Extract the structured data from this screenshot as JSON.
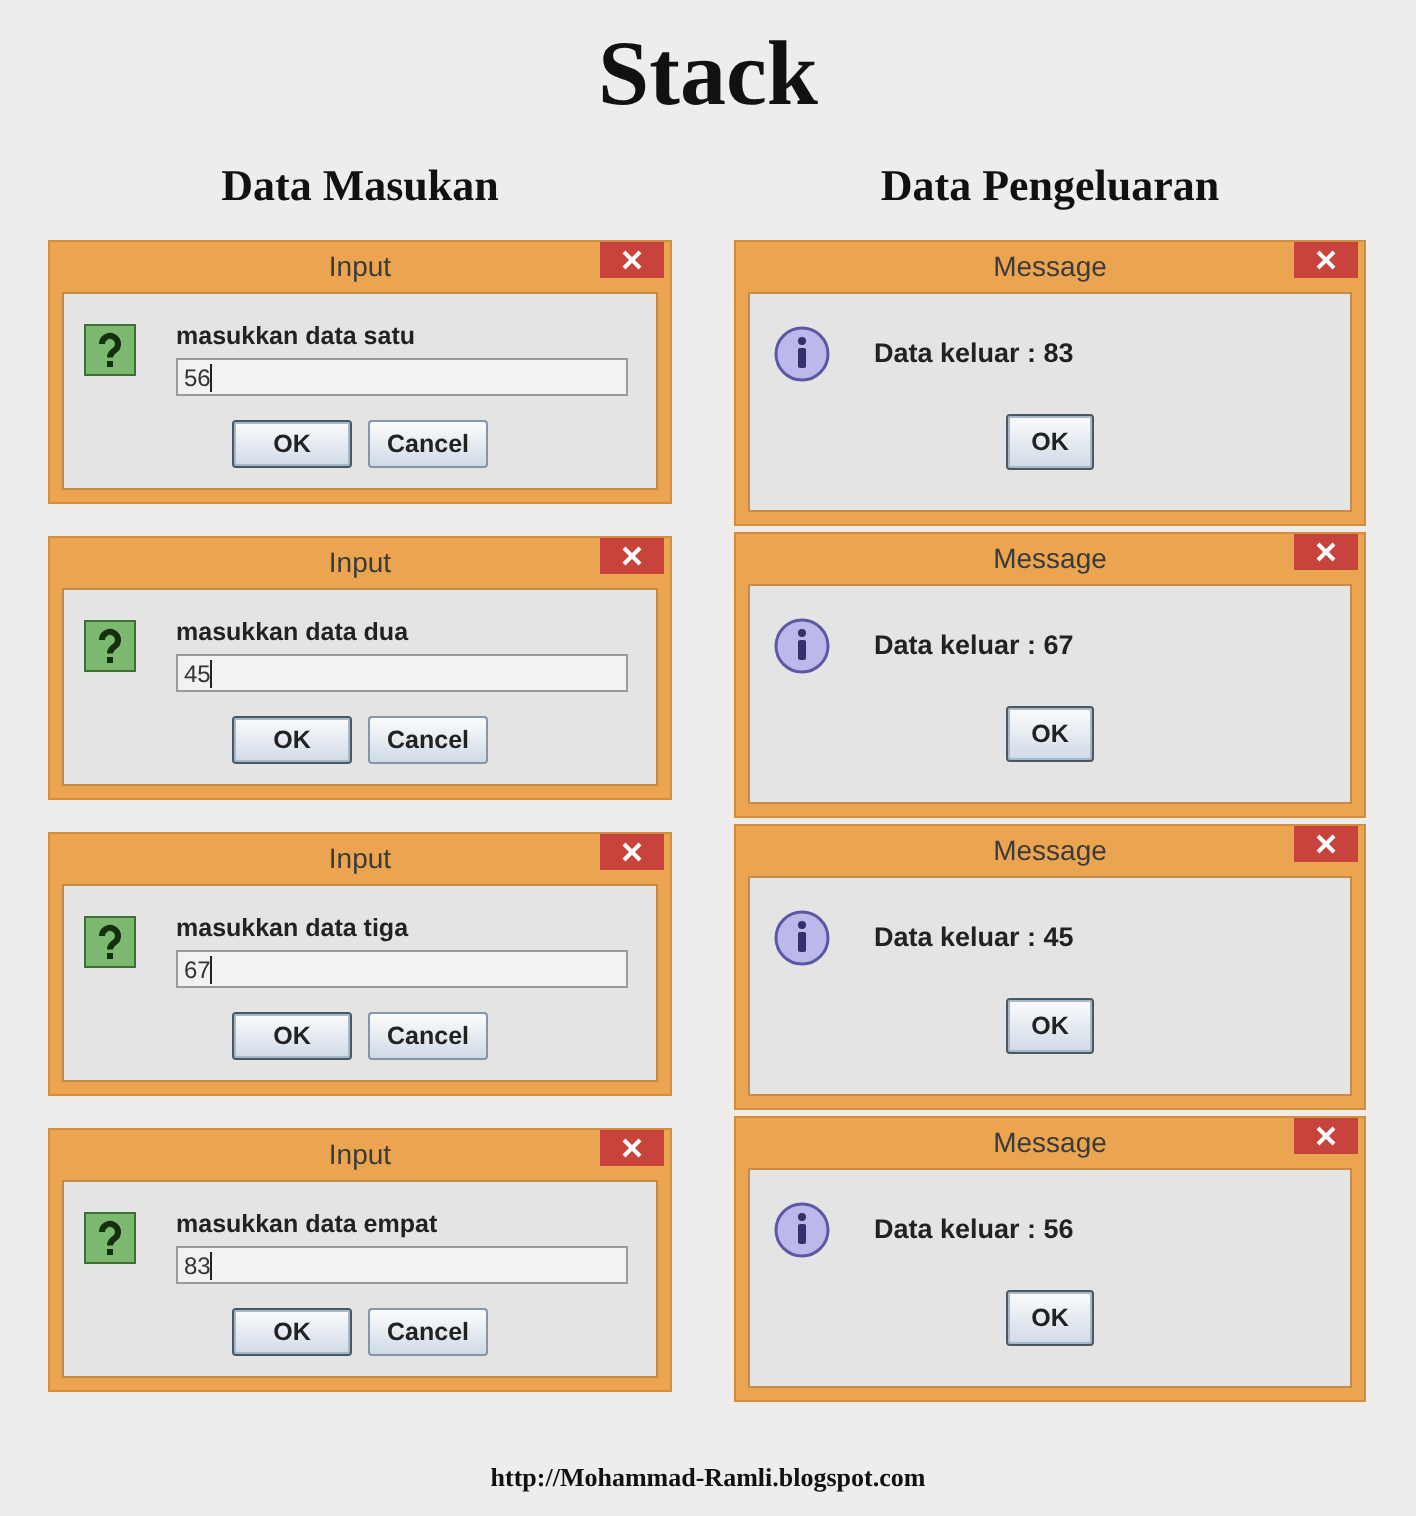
{
  "title": "Stack",
  "columns": [
    {
      "heading": "Data Masukan",
      "dialogs": [
        {
          "kind": "input",
          "title": "Input",
          "prompt": "masukkan data satu",
          "value": "56",
          "buttons": [
            {
              "label": "OK",
              "focused": true
            },
            {
              "label": "Cancel",
              "focused": false
            }
          ]
        },
        {
          "kind": "input",
          "title": "Input",
          "prompt": "masukkan data dua",
          "value": "45",
          "buttons": [
            {
              "label": "OK",
              "focused": true
            },
            {
              "label": "Cancel",
              "focused": false
            }
          ]
        },
        {
          "kind": "input",
          "title": "Input",
          "prompt": "masukkan data tiga",
          "value": "67",
          "buttons": [
            {
              "label": "OK",
              "focused": true
            },
            {
              "label": "Cancel",
              "focused": false
            }
          ]
        },
        {
          "kind": "input",
          "title": "Input",
          "prompt": "masukkan data empat",
          "value": "83",
          "buttons": [
            {
              "label": "OK",
              "focused": true
            },
            {
              "label": "Cancel",
              "focused": false
            }
          ]
        }
      ]
    },
    {
      "heading": "Data Pengeluaran",
      "dialogs": [
        {
          "kind": "message",
          "title": "Message",
          "message": "Data keluar : 83",
          "buttons": [
            {
              "label": "OK",
              "focused": true
            }
          ]
        },
        {
          "kind": "message",
          "title": "Message",
          "message": "Data keluar : 67",
          "buttons": [
            {
              "label": "OK",
              "focused": true
            }
          ]
        },
        {
          "kind": "message",
          "title": "Message",
          "message": "Data keluar : 45",
          "buttons": [
            {
              "label": "OK",
              "focused": true
            }
          ]
        },
        {
          "kind": "message",
          "title": "Message",
          "message": "Data keluar : 56",
          "buttons": [
            {
              "label": "OK",
              "focused": true
            }
          ]
        }
      ]
    }
  ],
  "footer": "http://Mohammad-Ramli.blogspot.com"
}
